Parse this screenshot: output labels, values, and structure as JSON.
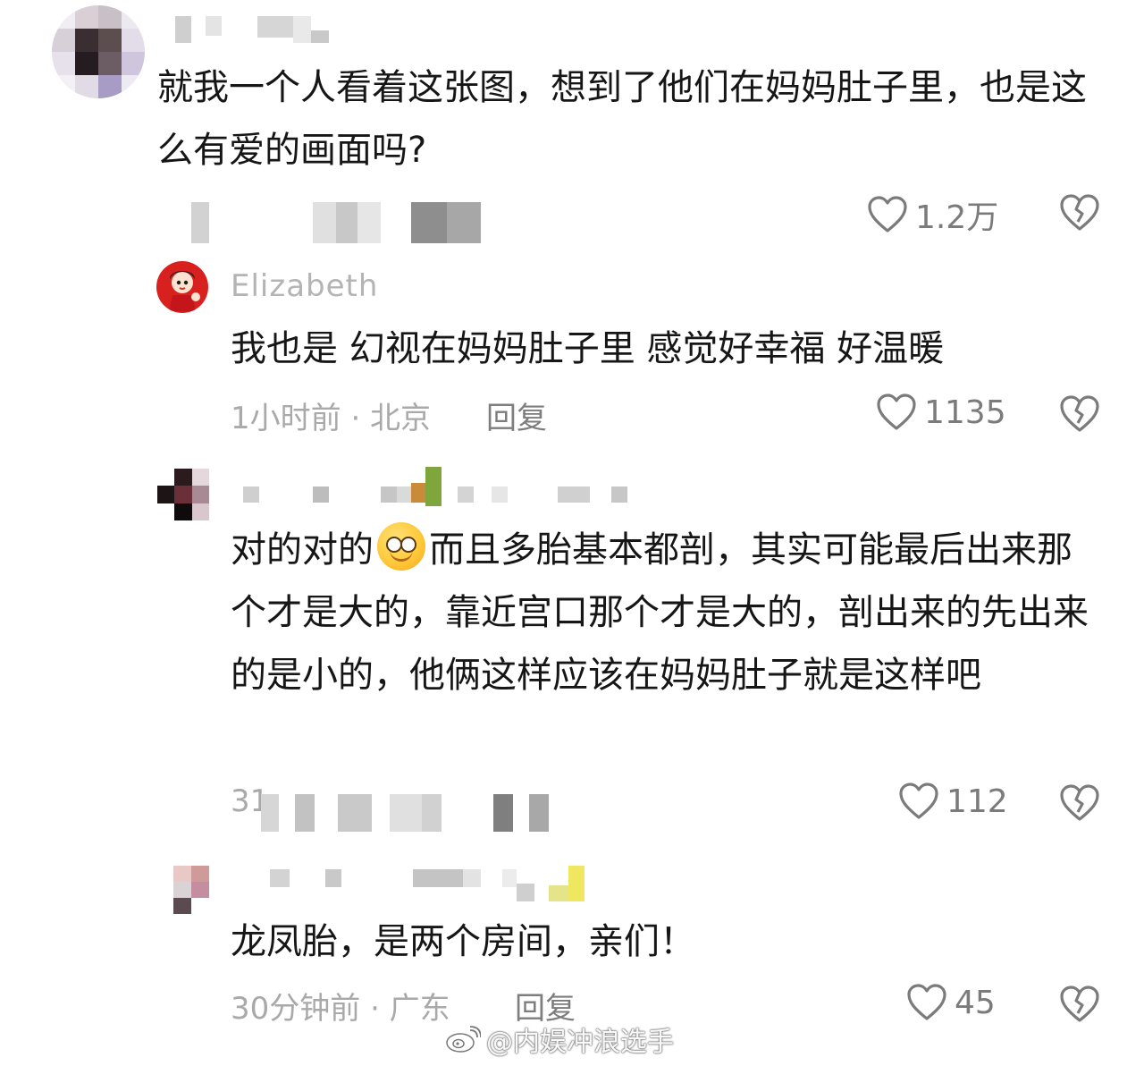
{
  "comments": [
    {
      "text": "就我一个人看着这张图，想到了他们在妈妈肚子里，也是这么有爱的画面吗?",
      "likes": "1.2万"
    },
    {
      "user": "Elizabeth",
      "text": "我也是 幻视在妈妈肚子里 感觉好幸福 好温暖",
      "time": "1小时前 · 北京",
      "reply": "回复",
      "likes": "1135"
    },
    {
      "text_a": "对的对的",
      "emoji": "grinning-emoji",
      "text_b": "而且多胎基本都剖，其实可能最后出来那个才是大的，靠近宫口那个才是大的，剖出来的先出来的是小的，他俩这样应该在妈妈肚子就是这样吧",
      "time_prefix": "31",
      "likes": "112"
    },
    {
      "text": "龙凤胎，是两个房间，亲们！",
      "time": "30分钟前 · 广东",
      "reply": "回复",
      "likes": "45"
    }
  ],
  "watermark": "@内娱冲浪选手",
  "colors": {
    "text": "#161616",
    "meta": "#a9a9a9",
    "icon": "#7b7b7b"
  }
}
